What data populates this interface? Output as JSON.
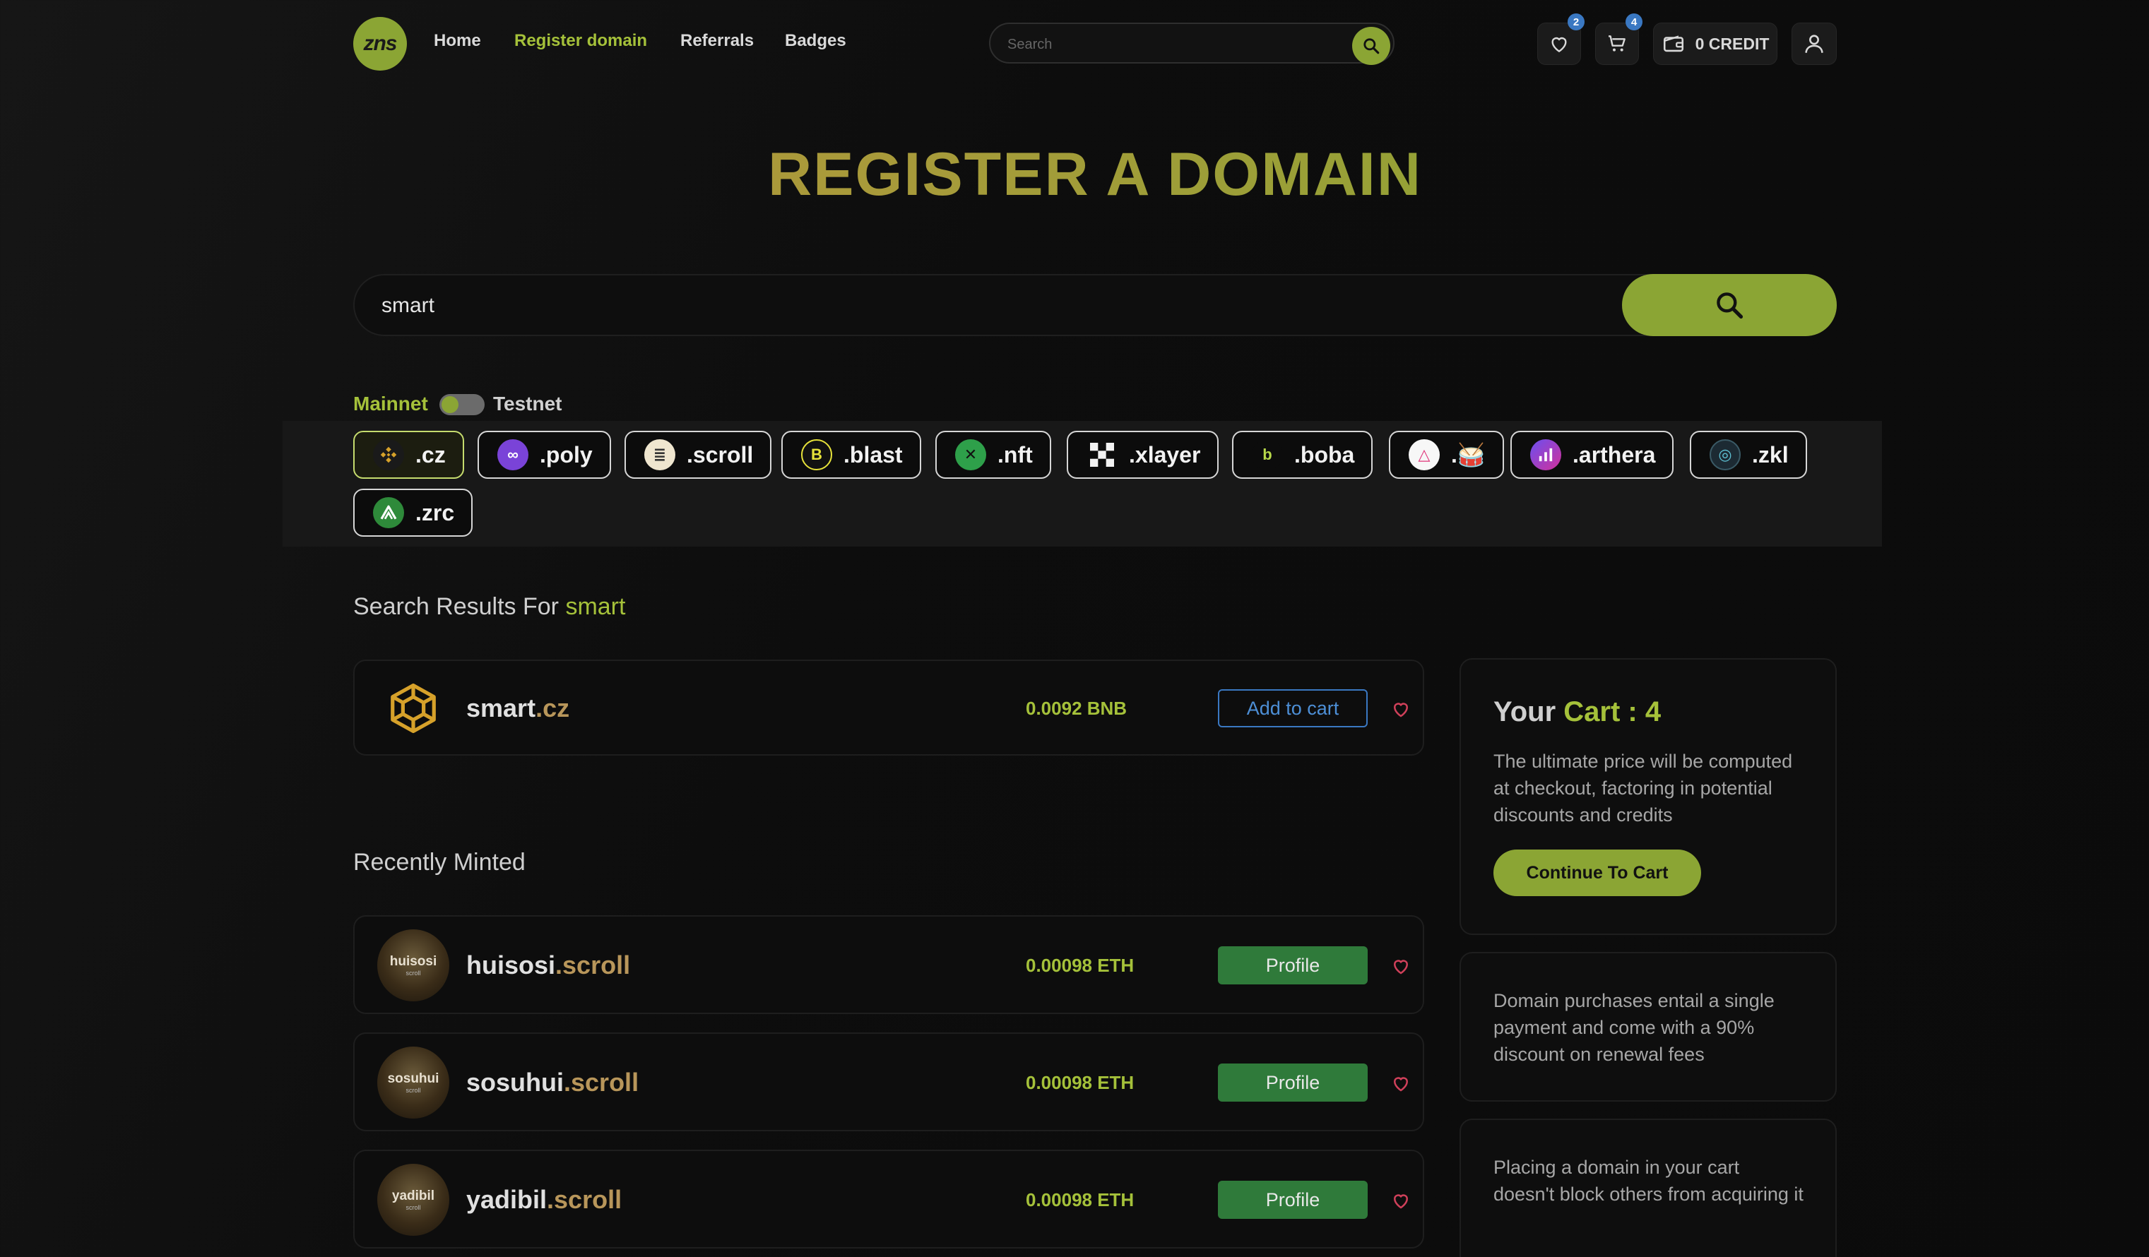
{
  "nav": {
    "logo_text": "zns",
    "links": [
      "Home",
      "Register domain",
      "Referrals",
      "Badges"
    ],
    "active_link": "Register domain",
    "search_placeholder": "Search",
    "wishlist_count": "2",
    "cart_count": "4",
    "credit_label": "0 CREDIT"
  },
  "hero": {
    "title": "REGISTER A DOMAIN",
    "search_value": "smart"
  },
  "network": {
    "mainnet_label": "Mainnet",
    "testnet_label": "Testnet",
    "selected": "Mainnet"
  },
  "tlds": [
    {
      "label": ".cz",
      "icon": "bnb-icon",
      "selected": true
    },
    {
      "label": ".poly",
      "icon": "polygon-icon"
    },
    {
      "label": ".scroll",
      "icon": "scroll-icon"
    },
    {
      "label": ".blast",
      "icon": "blast-icon"
    },
    {
      "label": ".nft",
      "icon": "nft-icon"
    },
    {
      "label": ".xlayer",
      "icon": "xlayer-icon"
    },
    {
      "label": ".boba",
      "icon": "boba-icon"
    },
    {
      "label": ".🥁",
      "icon": "taiko-icon"
    },
    {
      "label": ".arthera",
      "icon": "arthera-icon"
    },
    {
      "label": ".zkl",
      "icon": "zkl-icon"
    },
    {
      "label": ".zrc",
      "icon": "zrc-icon"
    }
  ],
  "results": {
    "title_prefix": "Search Results For",
    "query": "smart",
    "items": [
      {
        "name": "smart",
        "tld": ".cz",
        "price": "0.0092 BNB",
        "action": "Add to cart"
      }
    ]
  },
  "recent": {
    "title": "Recently Minted",
    "items": [
      {
        "name": "huisosi",
        "tld": ".scroll",
        "price": "0.00098 ETH",
        "action": "Profile",
        "avatar_text": "huisosi",
        "avatar_sub": "scroll"
      },
      {
        "name": "sosuhui",
        "tld": ".scroll",
        "price": "0.00098 ETH",
        "action": "Profile",
        "avatar_text": "sosuhui",
        "avatar_sub": "scroll"
      },
      {
        "name": "yadibil",
        "tld": ".scroll",
        "price": "0.00098 ETH",
        "action": "Profile",
        "avatar_text": "yadibil",
        "avatar_sub": "scroll"
      }
    ]
  },
  "cart_panel": {
    "title_prefix": "Your",
    "title_highlight": "Cart : 4",
    "description": "The ultimate price will be computed at checkout, factoring in potential discounts and credits",
    "button": "Continue To Cart"
  },
  "info_panels": [
    "Domain purchases entail a single payment and come with a 90% discount on renewal fees",
    "Placing a domain in your cart doesn't block others from acquiring it"
  ],
  "colors": {
    "accent": "#8ba534",
    "accent_text": "#a5c13a",
    "tld_text": "#b8965a",
    "profile_button": "#2f7a3a",
    "link_blue": "#3a78c2",
    "heart": "#d0405a"
  }
}
